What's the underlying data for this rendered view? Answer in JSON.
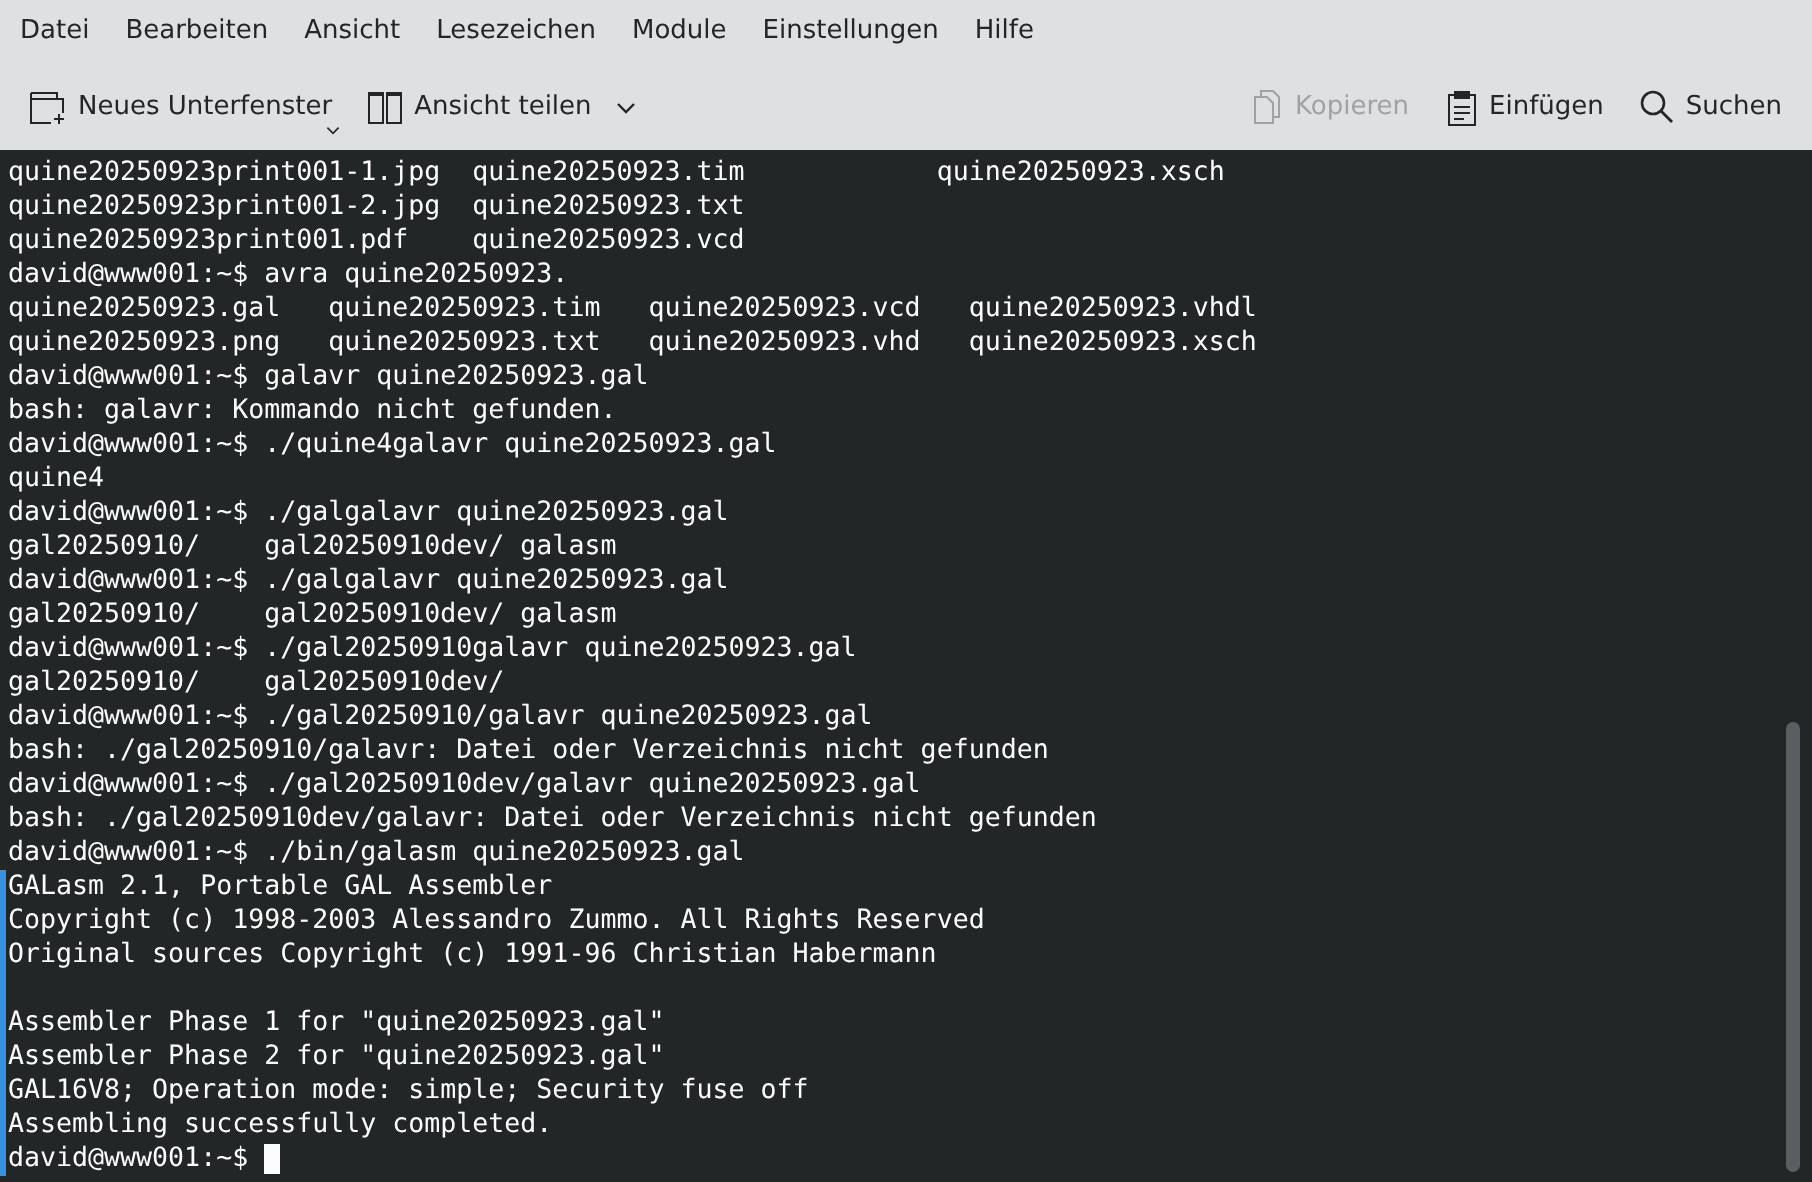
{
  "menu_bar": [
    "Datei",
    "Bearbeiten",
    "Ansicht",
    "Lesezeichen",
    "Module",
    "Einstellungen",
    "Hilfe"
  ],
  "toolbar": {
    "left": [
      {
        "label": "Neues Unterfenster",
        "disabled": false,
        "delayed_menu": true,
        "menu_arrow": false
      },
      {
        "label": "Ansicht teilen",
        "disabled": false,
        "delayed_menu": false,
        "menu_arrow": true
      }
    ],
    "right": [
      {
        "label": "Kopieren",
        "disabled": true
      },
      {
        "label": "Einfügen",
        "disabled": false
      },
      {
        "label": "Suchen",
        "disabled": false
      }
    ]
  },
  "terminal": {
    "lines": [
      {
        "kind": "text",
        "text": "quine20250923print001-1.jpg  quine20250923.tim            quine20250923.xsch",
        "marked": false
      },
      {
        "kind": "text",
        "text": "quine20250923print001-2.jpg  quine20250923.txt",
        "marked": false
      },
      {
        "kind": "text",
        "text": "quine20250923print001.pdf    quine20250923.vcd",
        "marked": false
      },
      {
        "kind": "text",
        "text": "david@www001:~$ avra quine20250923.",
        "marked": false
      },
      {
        "kind": "text",
        "text": "quine20250923.gal   quine20250923.tim   quine20250923.vcd   quine20250923.vhdl",
        "marked": false
      },
      {
        "kind": "text",
        "text": "quine20250923.png   quine20250923.txt   quine20250923.vhd   quine20250923.xsch",
        "marked": false
      },
      {
        "kind": "text",
        "text": "david@www001:~$ galavr quine20250923.gal",
        "marked": false
      },
      {
        "kind": "text",
        "text": "bash: galavr: Kommando nicht gefunden.",
        "marked": false
      },
      {
        "kind": "text",
        "text": "david@www001:~$ ./quine4galavr quine20250923.gal",
        "marked": false
      },
      {
        "kind": "text",
        "text": "quine4",
        "marked": false
      },
      {
        "kind": "text",
        "text": "david@www001:~$ ./galgalavr quine20250923.gal",
        "marked": false
      },
      {
        "kind": "text",
        "text": "gal20250910/    gal20250910dev/ galasm",
        "marked": false
      },
      {
        "kind": "text",
        "text": "david@www001:~$ ./galgalavr quine20250923.gal",
        "marked": false
      },
      {
        "kind": "text",
        "text": "gal20250910/    gal20250910dev/ galasm",
        "marked": false
      },
      {
        "kind": "text",
        "text": "david@www001:~$ ./gal20250910galavr quine20250923.gal",
        "marked": false
      },
      {
        "kind": "text",
        "text": "gal20250910/    gal20250910dev/",
        "marked": false
      },
      {
        "kind": "text",
        "text": "david@www001:~$ ./gal20250910/galavr quine20250923.gal",
        "marked": false
      },
      {
        "kind": "text",
        "text": "bash: ./gal20250910/galavr: Datei oder Verzeichnis nicht gefunden",
        "marked": false
      },
      {
        "kind": "text",
        "text": "david@www001:~$ ./gal20250910dev/galavr quine20250923.gal",
        "marked": false
      },
      {
        "kind": "text",
        "text": "bash: ./gal20250910dev/galavr: Datei oder Verzeichnis nicht gefunden",
        "marked": false
      },
      {
        "kind": "text",
        "text": "david@www001:~$ ./bin/galasm quine20250923.gal",
        "marked": false
      },
      {
        "kind": "text",
        "text": "GALasm 2.1, Portable GAL Assembler",
        "marked": true
      },
      {
        "kind": "text",
        "text": "Copyright (c) 1998-2003 Alessandro Zummo. All Rights Reserved",
        "marked": true
      },
      {
        "kind": "text",
        "text": "Original sources Copyright (c) 1991-96 Christian Habermann",
        "marked": true
      },
      {
        "kind": "blank",
        "marked": true
      },
      {
        "kind": "text",
        "text": "Assembler Phase 1 for \"quine20250923.gal\"",
        "marked": true
      },
      {
        "kind": "text",
        "text": "Assembler Phase 2 for \"quine20250923.gal\"",
        "marked": true
      },
      {
        "kind": "text",
        "text": "GAL16V8; Operation mode: simple; Security fuse off",
        "marked": true
      },
      {
        "kind": "text",
        "text": "Assembling successfully completed.",
        "marked": true
      },
      {
        "kind": "text",
        "text": "david@www001:~$",
        "marked": true,
        "cursor": true
      }
    ]
  }
}
